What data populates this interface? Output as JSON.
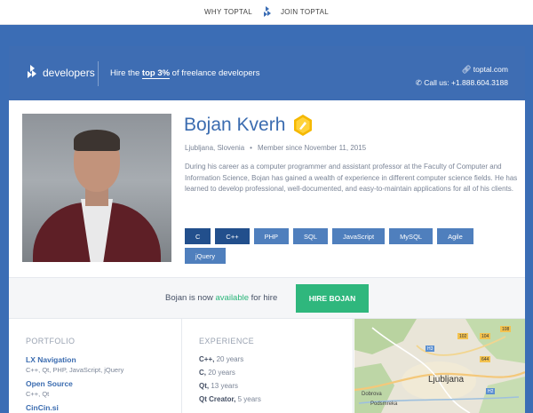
{
  "topnav": {
    "why": "WHY TOPTAL",
    "join": "JOIN TOPTAL"
  },
  "header": {
    "brand": "developers",
    "tagline_pre": "Hire the ",
    "tagline_bold": "top 3%",
    "tagline_post": " of freelance developers",
    "site": "toptal.com",
    "phone": "Call us: +1.888.604.3188"
  },
  "profile": {
    "name": "Bojan Kverh",
    "location": "Ljubljana, Slovenia",
    "member_since": "Member since November 11, 2015",
    "bio": "During his career as a computer programmer and assistant professor at the Faculty of Computer and Information Science, Bojan has gained a wealth of experience in different computer science fields. He has learned to develop professional, well-documented, and easy-to-maintain applications for all of his clients.",
    "skills": [
      "C",
      "C++",
      "PHP",
      "SQL",
      "JavaScript",
      "MySQL",
      "Agile",
      "jQuery"
    ]
  },
  "availability": {
    "pre": "Bojan is now ",
    "status": "available",
    "post": " for hire",
    "button": "HIRE BOJAN"
  },
  "portfolio": {
    "title": "PORTFOLIO",
    "items": [
      {
        "title": "LX Navigation",
        "desc": "C++, Qt, PHP, JavaScript, jQuery"
      },
      {
        "title": "Open Source",
        "desc": "C++, Qt"
      },
      {
        "title": "CinCin.si",
        "desc": ""
      }
    ]
  },
  "experience": {
    "title": "EXPERIENCE",
    "items": [
      {
        "skill": "C++,",
        "years": "20 years"
      },
      {
        "skill": "C,",
        "years": "20 years"
      },
      {
        "skill": "Qt,",
        "years": "13 years"
      },
      {
        "skill": "Qt Creator,",
        "years": "5 years"
      }
    ]
  },
  "map": {
    "city": "Ljubljana",
    "labels": [
      "Dobrova",
      "Podsmreka"
    ],
    "road_numbers": [
      "102",
      "104",
      "108",
      "H3",
      "644",
      "H2"
    ]
  },
  "colors": {
    "brand_blue": "#3e6db3",
    "hire_green": "#2fb77d",
    "skill_dark": "#224f8c",
    "skill_light": "#4f7fbd"
  }
}
